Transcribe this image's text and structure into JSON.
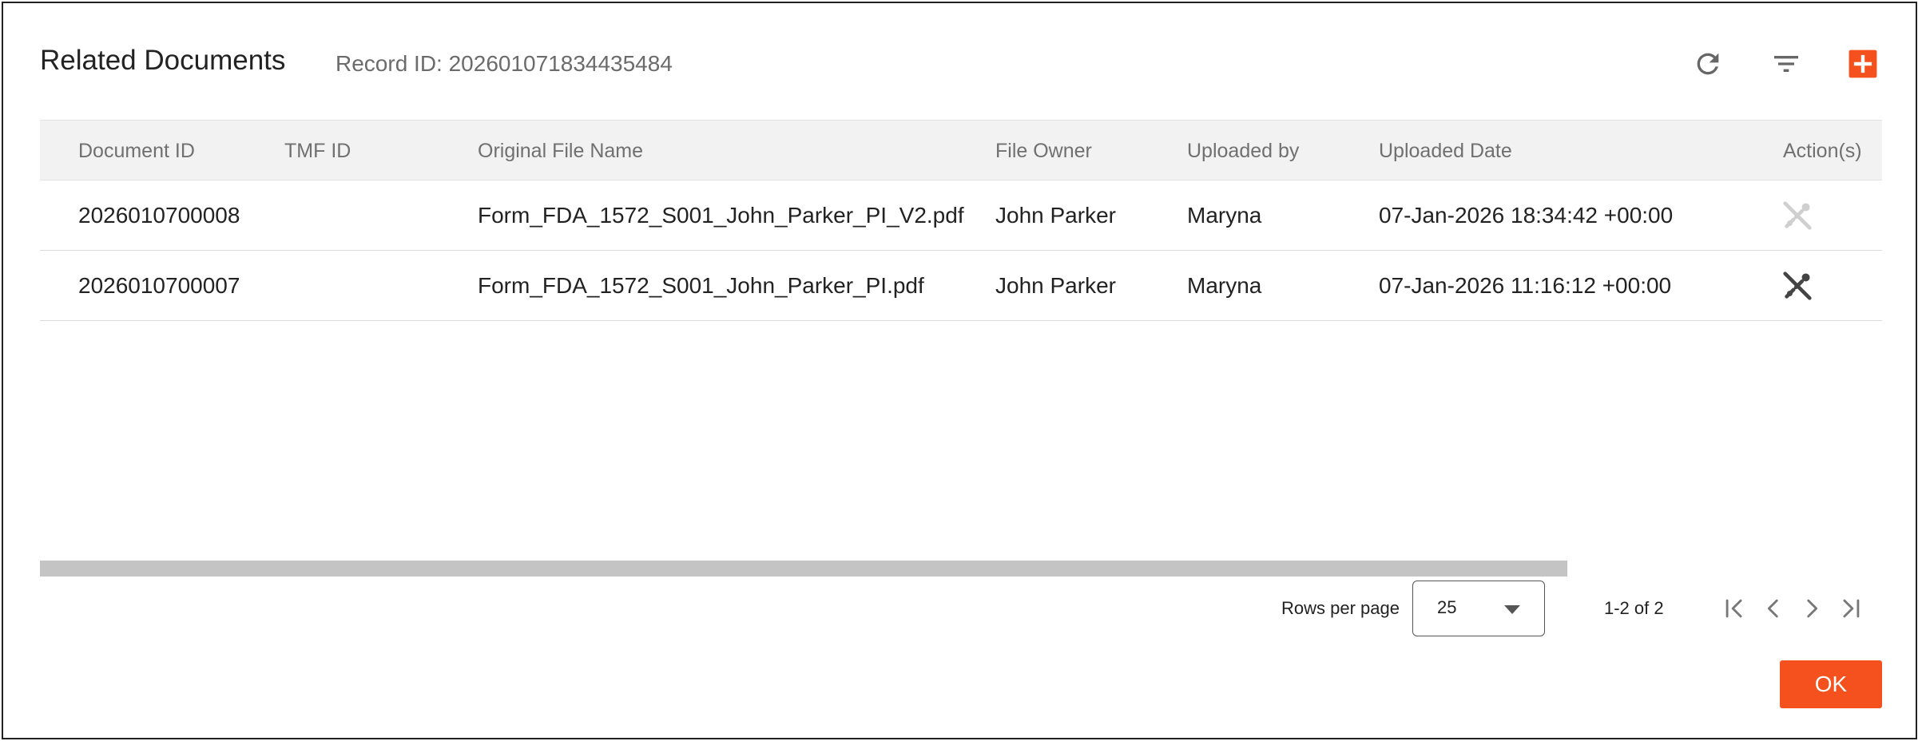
{
  "dialog": {
    "title": "Related Documents",
    "record_id_text": "Record ID: 202601071834435484"
  },
  "toolbar": {
    "icons": [
      "refresh-icon",
      "filter-icon",
      "add-icon"
    ],
    "accent_color": "#f4511e"
  },
  "table": {
    "columns": [
      "Document ID",
      "TMF ID",
      "Original File Name",
      "File Owner",
      "Uploaded by",
      "Uploaded Date",
      "Action(s)"
    ],
    "rows": [
      {
        "document_id": "2026010700008",
        "tmf_id": "",
        "file_name": "Form_FDA_1572_S001_John_Parker_PI_V2.pdf",
        "file_owner": "John Parker",
        "uploaded_by": "Maryna",
        "uploaded_date": "07-Jan-2026 18:34:42 +00:00",
        "action_icon": "unlink-icon",
        "action_enabled": false
      },
      {
        "document_id": "2026010700007",
        "tmf_id": "",
        "file_name": "Form_FDA_1572_S001_John_Parker_PI.pdf",
        "file_owner": "John Parker",
        "uploaded_by": "Maryna",
        "uploaded_date": "07-Jan-2026 11:16:12 +00:00",
        "action_icon": "unlink-icon",
        "action_enabled": true
      }
    ]
  },
  "pagination": {
    "rows_per_page_label": "Rows per page",
    "rows_per_page_value": "25",
    "range_text": "1-2 of 2"
  },
  "footer": {
    "ok_label": "OK"
  }
}
